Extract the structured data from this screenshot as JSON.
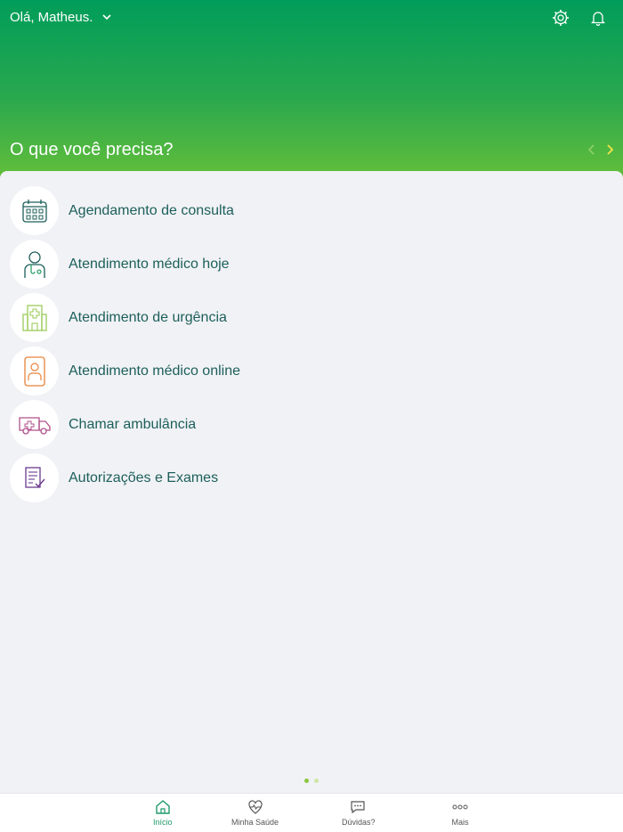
{
  "header": {
    "greeting": "Olá, Matheus.",
    "question": "O que você precisa?",
    "icons": [
      "chevron-down-icon",
      "settings-gear-icon",
      "bell-icon",
      "chevron-left-icon",
      "chevron-right-icon"
    ]
  },
  "services": [
    {
      "label": "Agendamento de consulta",
      "icon": "calendar-icon"
    },
    {
      "label": "Atendimento médico hoje",
      "icon": "doctor-icon"
    },
    {
      "label": "Atendimento de urgência",
      "icon": "hospital-icon"
    },
    {
      "label": "Atendimento médico online",
      "icon": "mobile-doctor-icon"
    },
    {
      "label": "Chamar ambulância",
      "icon": "ambulance-icon"
    },
    {
      "label": "Autorizações e Exames",
      "icon": "document-check-icon"
    }
  ],
  "pagination": {
    "pages": 2,
    "current": 1
  },
  "bottom_nav": {
    "items": [
      {
        "label": "Início",
        "icon": "home-icon",
        "active": true
      },
      {
        "label": "Minha Saúde",
        "icon": "heart-pulse-icon",
        "active": false
      },
      {
        "label": "Dúvidas?",
        "icon": "chat-icon",
        "active": false
      },
      {
        "label": "Mais",
        "icon": "more-icon",
        "active": false
      }
    ]
  },
  "colors": {
    "brand_green": "#009d5a",
    "light_green": "#62be3a",
    "text_teal": "#1c5f5a",
    "active_nav": "#1f9a6a"
  }
}
